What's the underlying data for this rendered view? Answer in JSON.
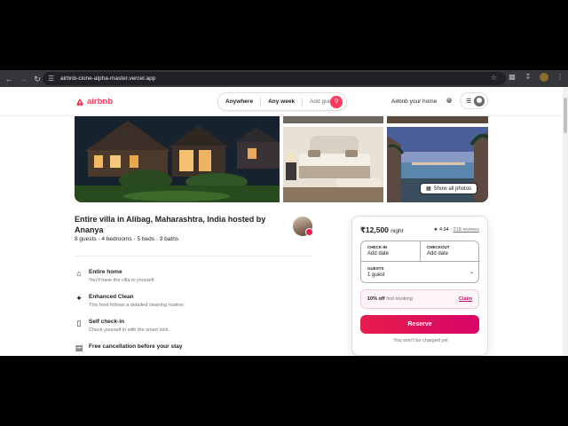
{
  "browser": {
    "url": "airbnb-clone-alpha-master.vercel.app",
    "back_icon": "arrow-left-icon",
    "forward_icon": "arrow-right-icon",
    "reload_icon": "reload-icon"
  },
  "header": {
    "brand": "airbnb",
    "search": {
      "where": "Anywhere",
      "when": "Any week",
      "who": "Add guests"
    },
    "host_link": "Airbnb your home"
  },
  "photos": {
    "show_all_label": "Show all photos"
  },
  "listing": {
    "title": "Entire villa in Alibag, Maharashtra, India hosted by Ananya",
    "meta": "8 guests · 4 bedrooms · 5 beds · 3 baths"
  },
  "features": [
    {
      "icon": "home-icon",
      "title": "Entire home",
      "desc": "You'll have the villa to yourself."
    },
    {
      "icon": "sparkles-icon",
      "title": "Enhanced Clean",
      "desc": "This host follows a detailed cleaning routine."
    },
    {
      "icon": "door-icon",
      "title": "Self check-in",
      "desc": "Check yourself in with the smart lock."
    },
    {
      "icon": "calendar-icon",
      "title": "Free cancellation before your stay",
      "desc": ""
    }
  ],
  "booking": {
    "price": "₹12,500",
    "per": "night",
    "rating": "4.94",
    "separator": "·",
    "reviews": "218 reviews",
    "checkin_label": "CHECK-IN",
    "checkin_value": "Add date",
    "checkout_label": "CHECKOUT",
    "checkout_value": "Add date",
    "guests_label": "GUESTS",
    "guests_value": "1 guest",
    "promo_bold": "10% off",
    "promo_text": "first booking",
    "promo_action": "Claim",
    "reserve_label": "Reserve",
    "note": "You won't be charged yet"
  },
  "colors": {
    "brand": "#ff385c",
    "reserve_start": "#e61e4d",
    "reserve_end": "#d70466"
  }
}
